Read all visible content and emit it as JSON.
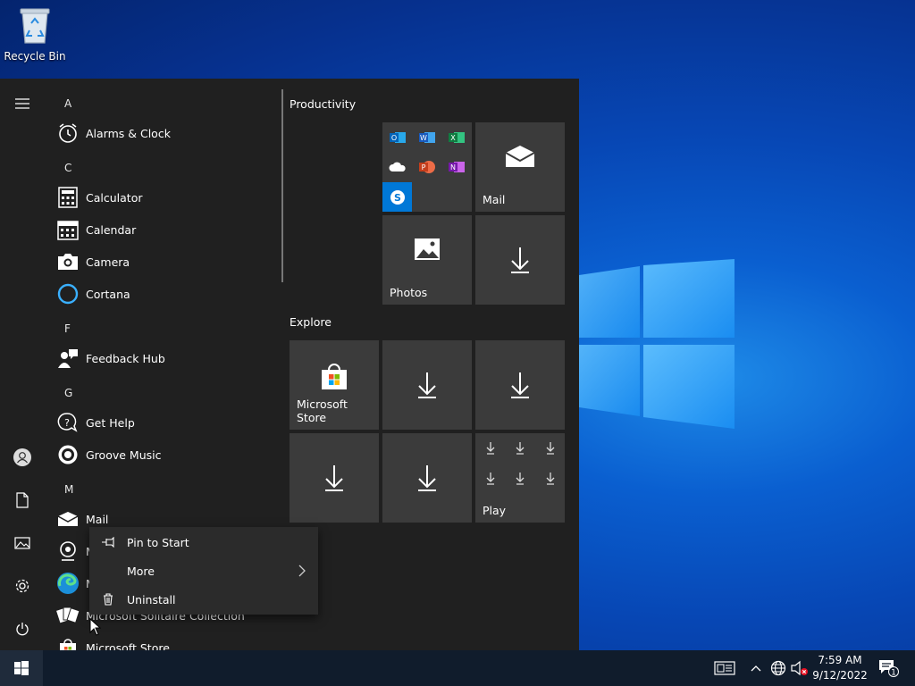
{
  "desktop": {
    "recycle_bin_label": "Recycle Bin"
  },
  "applist": {
    "letters": {
      "a": "A",
      "c": "C",
      "f": "F",
      "g": "G",
      "m": "M"
    },
    "apps": {
      "alarms": "Alarms & Clock",
      "calculator": "Calculator",
      "calendar": "Calendar",
      "camera": "Camera",
      "cortana": "Cortana",
      "feedback": "Feedback Hub",
      "gethelp": "Get Help",
      "groove": "Groove Music",
      "mail": "Mail",
      "maps": "M",
      "edge": "M",
      "solitaire": "Microsoft Solitaire Collection",
      "store": "Microsoft Store"
    }
  },
  "groups": {
    "productivity": "Productivity",
    "explore": "Explore"
  },
  "tiles": {
    "mail": "Mail",
    "photos": "Photos",
    "store": "Microsoft Store",
    "play": "Play",
    "office_apps": {
      "outlook": "O",
      "word": "W",
      "excel": "X",
      "powerpoint": "P",
      "onenote": "N",
      "skype": "S"
    }
  },
  "context_menu": {
    "pin": "Pin to Start",
    "more": "More",
    "uninstall": "Uninstall"
  },
  "taskbar": {
    "time": "7:59 AM",
    "date": "9/12/2022",
    "notification_count": "1"
  },
  "colors": {
    "accent": "#0078d7",
    "menu_bg": "#202020",
    "tile_bg": "#3b3b3b"
  }
}
